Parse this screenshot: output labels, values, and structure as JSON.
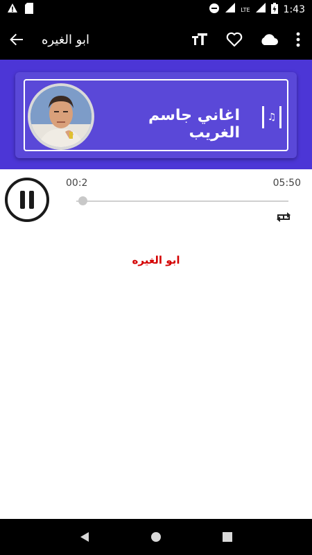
{
  "status_bar": {
    "time": "1:43",
    "network": "LTE"
  },
  "app_bar": {
    "title": "ابو الغيره"
  },
  "banner": {
    "title": "اغاني جاسم الغريب"
  },
  "player": {
    "elapsed": "00:2",
    "duration": "05:50",
    "progress": 0.01
  },
  "song": {
    "label": "ابو الغيره"
  },
  "colors": {
    "banner_bg": "#4c36d6",
    "banner_card": "#5a48d8",
    "song_label": "#d40000"
  }
}
